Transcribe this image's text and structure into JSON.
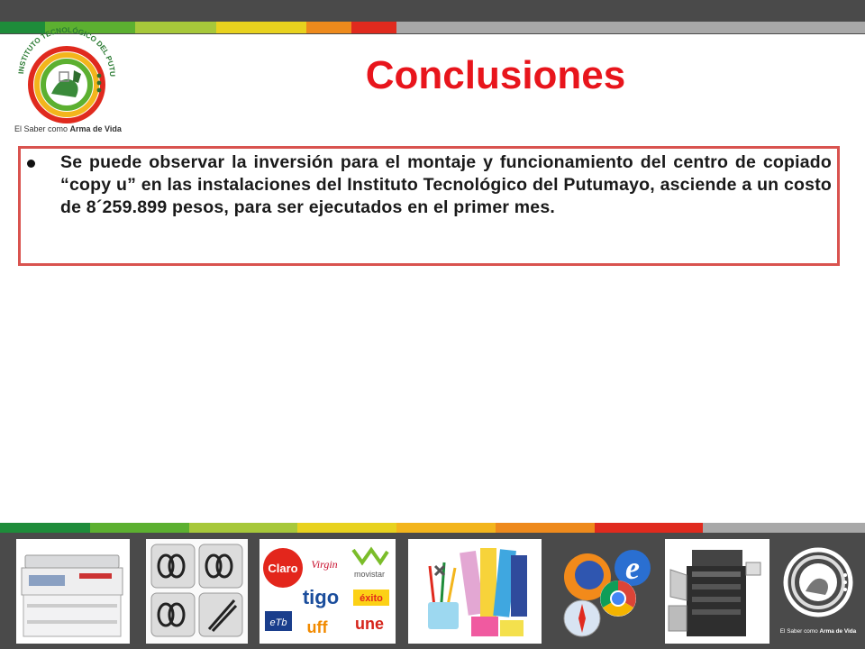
{
  "header": {
    "title": "Conclusiones"
  },
  "logo": {
    "arc_text": "INSTITUTO TECNOLÓGICO DEL PUTUMAYO",
    "tagline_prefix": "El Saber como ",
    "tagline_emphasis": "Arma de Vida"
  },
  "content": {
    "bullet": "Se puede observar la inversión para el montaje y funcionamiento del centro de copiado “copy u” en las instalaciones del Instituto Tecnológico del Putumayo, asciende a un costo de 8´259.899 pesos, para ser ejecutados en el primer mes."
  },
  "footer": {
    "images": [
      {
        "name": "copier-image",
        "kind": "copier"
      },
      {
        "name": "binding-rings-image",
        "kind": "binding"
      },
      {
        "name": "brand-logos-image",
        "kind": "brands"
      },
      {
        "name": "school-supplies-image",
        "kind": "supplies"
      },
      {
        "name": "browser-icons-image",
        "kind": "browsers"
      },
      {
        "name": "large-copier-image",
        "kind": "large-copier"
      }
    ],
    "brands": [
      "Claro",
      "Virgin",
      "movistar",
      "tigo",
      "éxito",
      "eTb",
      "uff",
      "une"
    ],
    "logo_tagline_prefix": "El Saber como ",
    "logo_tagline_emphasis": "Arma de Vida"
  },
  "colors": {
    "title": "#e8151c",
    "box_border": "#d9534f",
    "dark_bar": "#4a4a4a",
    "stripe": [
      "#1e8c3a",
      "#5cb030",
      "#a7c83a",
      "#e8d21e",
      "#f3b51c",
      "#ee8a1c",
      "#e02a1e",
      "#a8a8a8"
    ]
  }
}
